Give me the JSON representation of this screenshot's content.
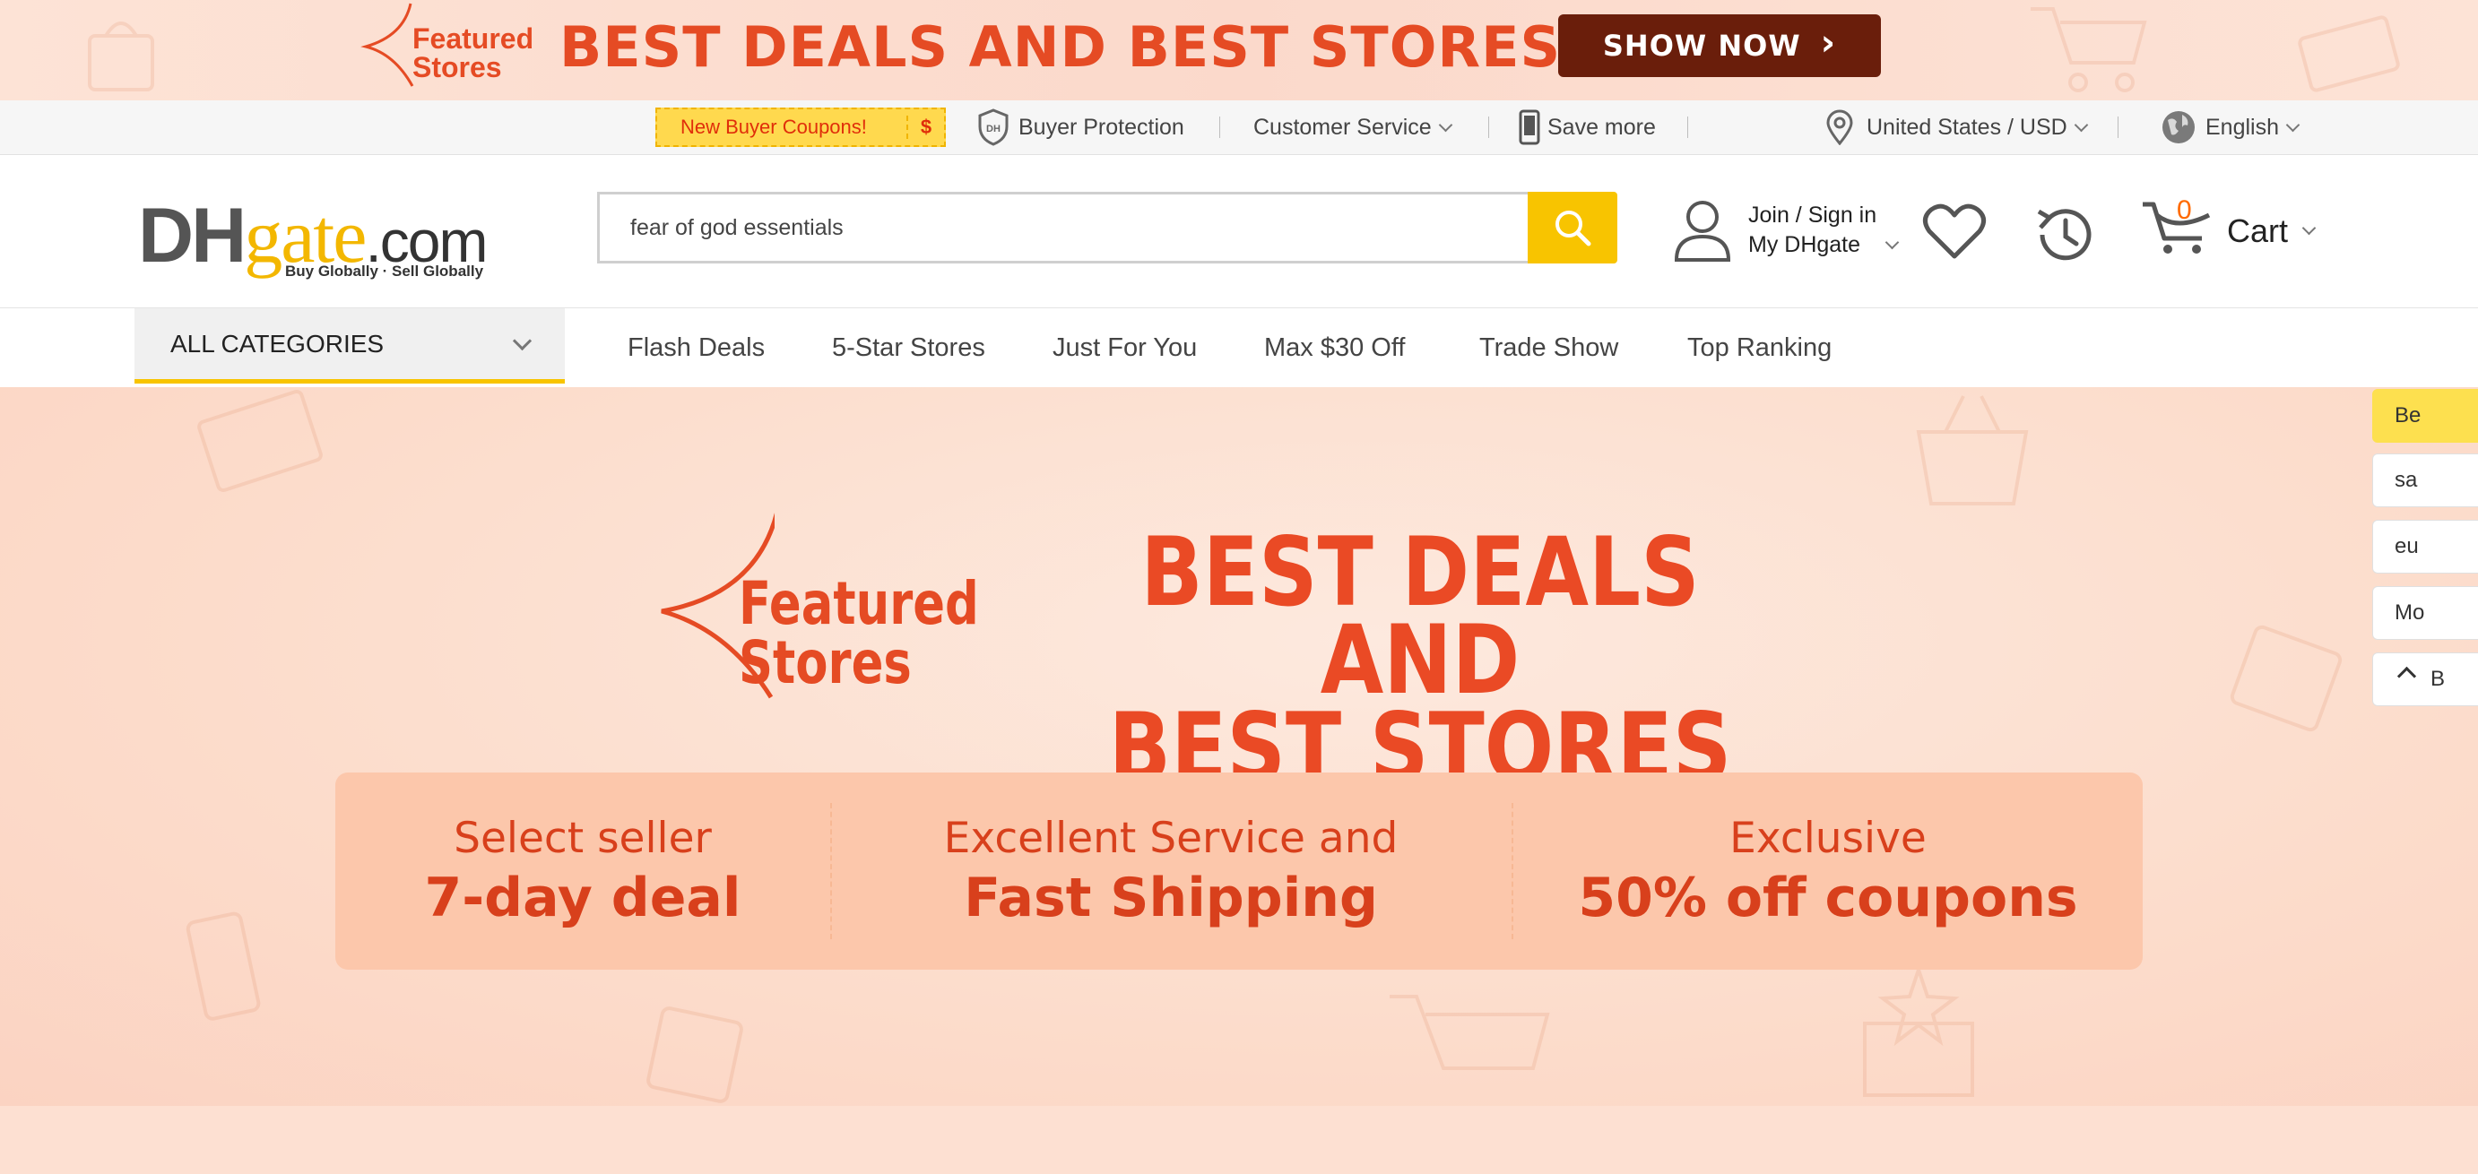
{
  "promo": {
    "featured": [
      "Featured",
      "Stores"
    ],
    "headline": "BEST DEALS AND BEST STORES",
    "show_now": "SHOW NOW",
    "arrow": "›"
  },
  "utility": {
    "coupon_label": "New Buyer Coupons!",
    "coupon_symbol": "$",
    "buyer_protection": "Buyer Protection",
    "customer_service": "Customer Service",
    "save_more": "Save more",
    "region": "United States / USD",
    "language": "English"
  },
  "header": {
    "logo": {
      "dh": "DH",
      "gate": "gate",
      "com": ".com",
      "tagline": "Buy Globally · Sell Globally"
    },
    "search": {
      "value": "fear of god essentials"
    },
    "account": {
      "line1": "Join / Sign in",
      "line2": "My DHgate"
    },
    "cart": {
      "count": "0",
      "label": "Cart"
    }
  },
  "nav": {
    "all_categories": "ALL CATEGORIES",
    "links": [
      "Flash Deals",
      "5-Star Stores",
      "Just For You",
      "Max $30 Off",
      "Trade Show",
      "Top Ranking"
    ]
  },
  "hero": {
    "featured": [
      "Featured",
      "Stores"
    ],
    "title_line1": "BEST DEALS AND",
    "title_line2": "BEST STORES",
    "benefits": [
      {
        "line1": "Select seller",
        "line2": "7-day deal"
      },
      {
        "line1": "Excellent Service and",
        "line2": "Fast Shipping"
      },
      {
        "line1": "Exclusive",
        "line2": "50% off coupons"
      }
    ]
  },
  "side_panel": {
    "items": [
      "Be",
      "sa",
      "eu",
      "Mo",
      "B"
    ]
  },
  "colors": {
    "accent_yellow": "#f8c400",
    "promo_red": "#e54b24",
    "show_now_bg": "#6a1e0b",
    "hero_bg": "#fcdccb"
  },
  "icons": [
    "location-pin-icon",
    "globe-icon",
    "shield-icon",
    "phone-icon",
    "search-icon",
    "user-icon",
    "heart-icon",
    "history-icon",
    "cart-icon"
  ]
}
